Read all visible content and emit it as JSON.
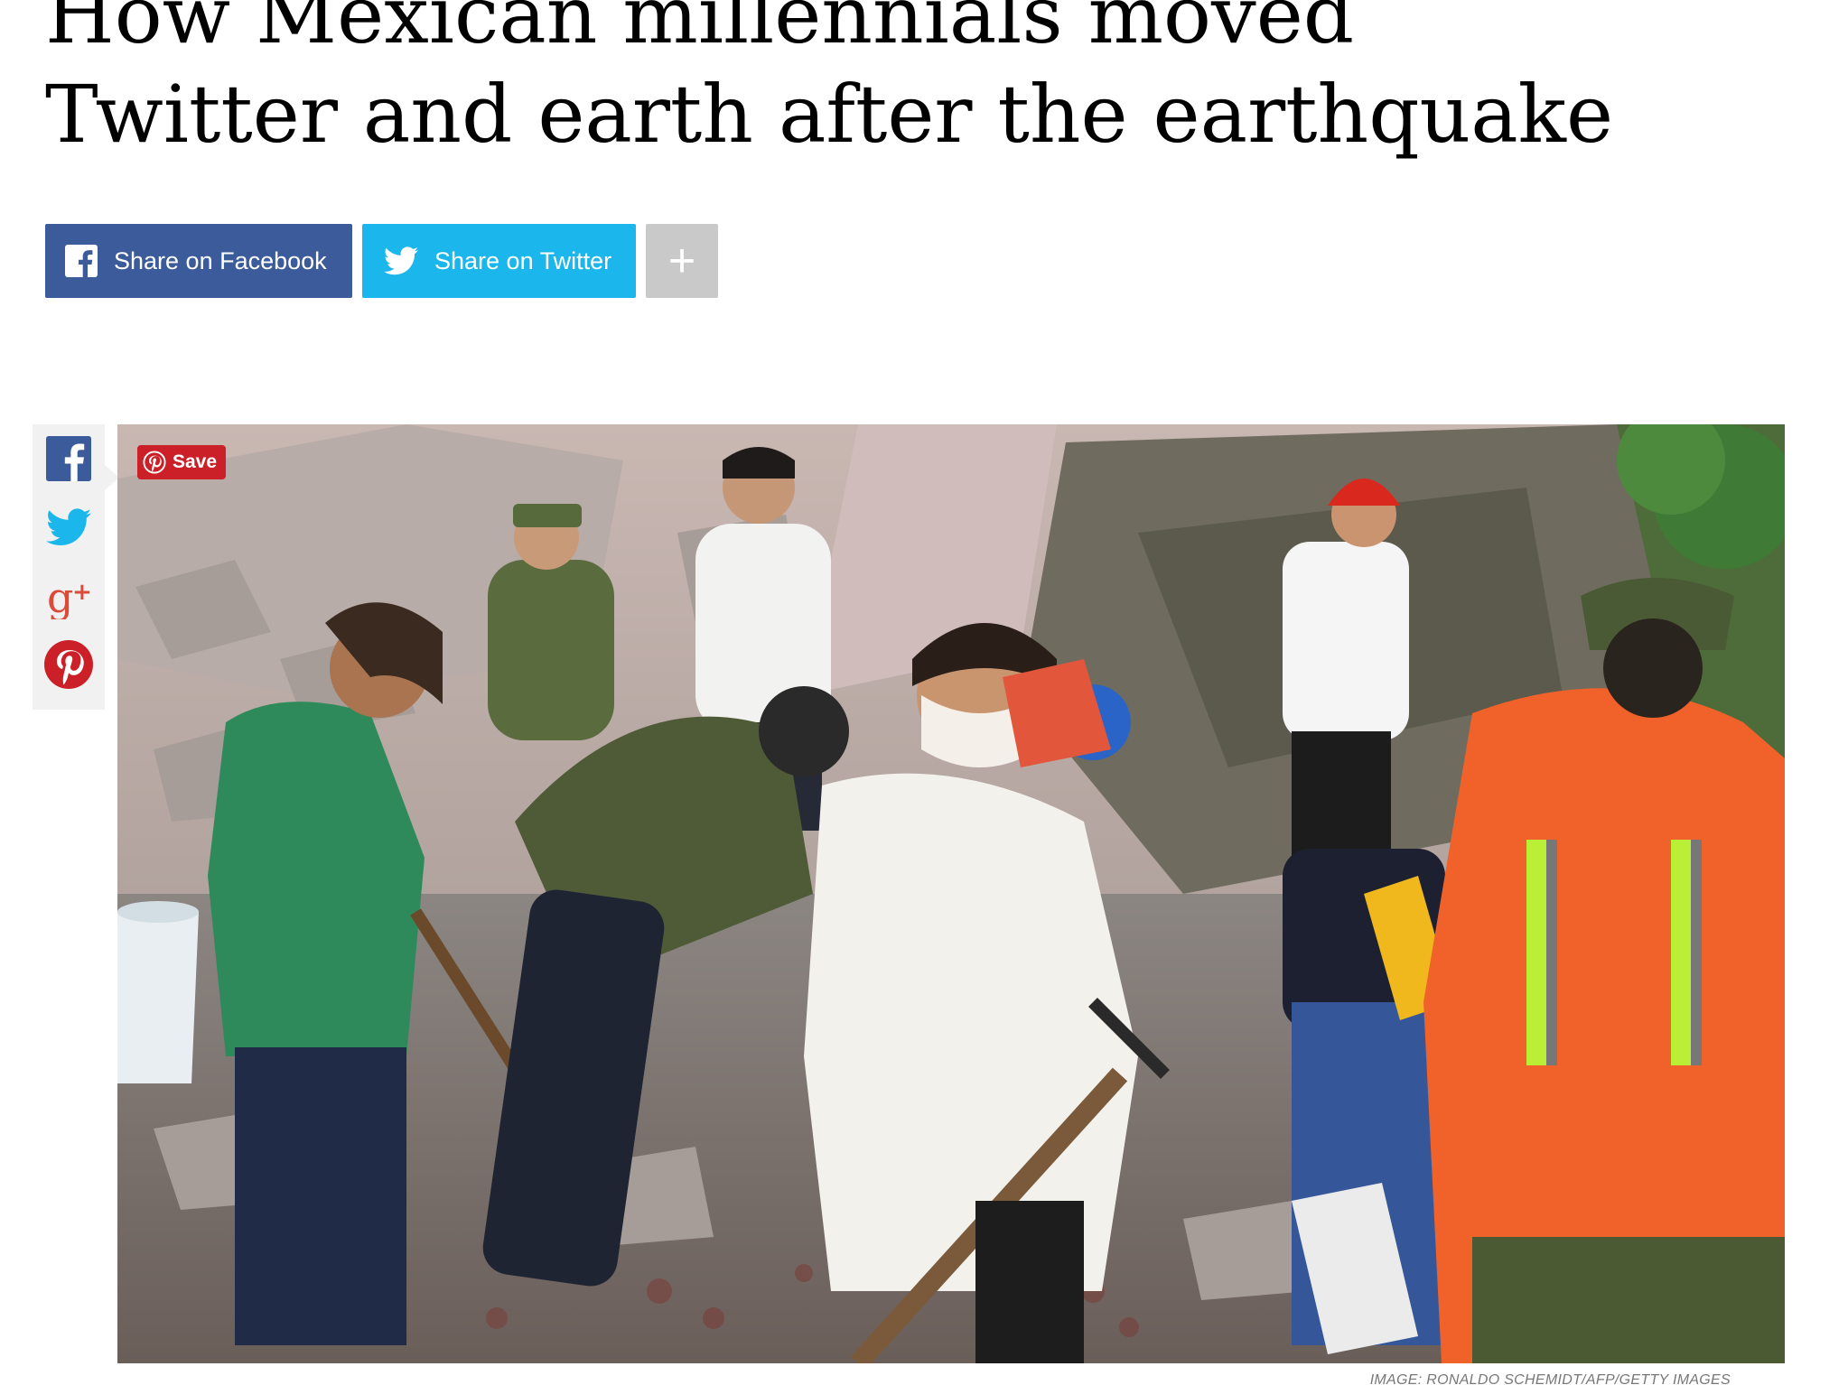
{
  "article": {
    "headline_line1": "How Mexican millennials moved",
    "headline_line2": "Twitter and earth after the earthquake"
  },
  "share": {
    "facebook_label": "Share on Facebook",
    "twitter_label": "Share on Twitter",
    "more_label": "+",
    "facebook_color": "#3b5b9b",
    "twitter_color": "#1ab6ec",
    "more_color": "#c9c9c9"
  },
  "social_rail": {
    "items": [
      {
        "icon": "facebook-icon",
        "color": "#3b5b9b"
      },
      {
        "icon": "twitter-icon",
        "color": "#1ab6ec"
      },
      {
        "icon": "google-plus-icon",
        "color": "#dc4a38"
      },
      {
        "icon": "pinterest-icon",
        "color": "#cb2027"
      }
    ]
  },
  "hero": {
    "pin_save_label": "Save",
    "credit": "IMAGE: RONALDO SCHEMIDT/AFP/GETTY IMAGES"
  }
}
